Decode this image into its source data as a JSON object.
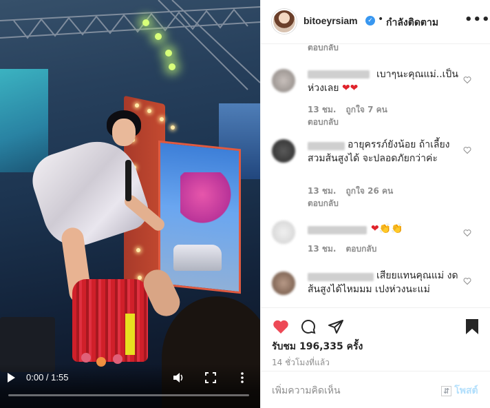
{
  "video": {
    "time_display": "0:00 / 1:55",
    "progress": 0.0,
    "icons": {
      "play": "play-icon",
      "volume": "volume-icon",
      "fullscreen": "fullscreen-icon",
      "more": "more-vertical-icon"
    }
  },
  "header": {
    "username": "bitoeyrsiam",
    "verified_glyph": "✓",
    "separator": "•",
    "follow_state": "กำลังติดตาม",
    "more_label": "•••"
  },
  "comments": [
    {
      "top_reply": "ตอบกลับ"
    },
    {
      "text": "เบาๆนะคุณแม่..เป็นห่วงเลย",
      "emoji": "❤❤",
      "time": "13 ชม.",
      "likes": "ถูกใจ 7 คน",
      "reply": "ตอบกลับ"
    },
    {
      "text": "อายุครรภ์ยังน้อย ถ้าเลี้ยงสวมส้นสูงได้ จะปลอดภัยกว่าค่ะ",
      "time": "13 ชม.",
      "likes": "ถูกใจ 26 คน",
      "reply": "ตอบกลับ"
    },
    {
      "emoji_heart": "❤",
      "emoji_hands": "👏👏",
      "time": "13 ชม.",
      "reply": "ตอบกลับ"
    },
    {
      "text": "เสียยแทนคุณแม่ งดส้นสูงได้ไหมมม เปงห่วงนะแม่"
    }
  ],
  "actions": {
    "icons": [
      "heart-filled-icon",
      "comment-icon",
      "share-icon",
      "save-bookmark-icon"
    ],
    "like_color": "#ed4956",
    "views": "รับชม 196,335 ครั้ง",
    "posted_ago": "14 ชั่วโมงที่แล้ว"
  },
  "add_comment": {
    "placeholder": "เพิ่มความคิดเห็น",
    "post_label": "โพสต์"
  }
}
